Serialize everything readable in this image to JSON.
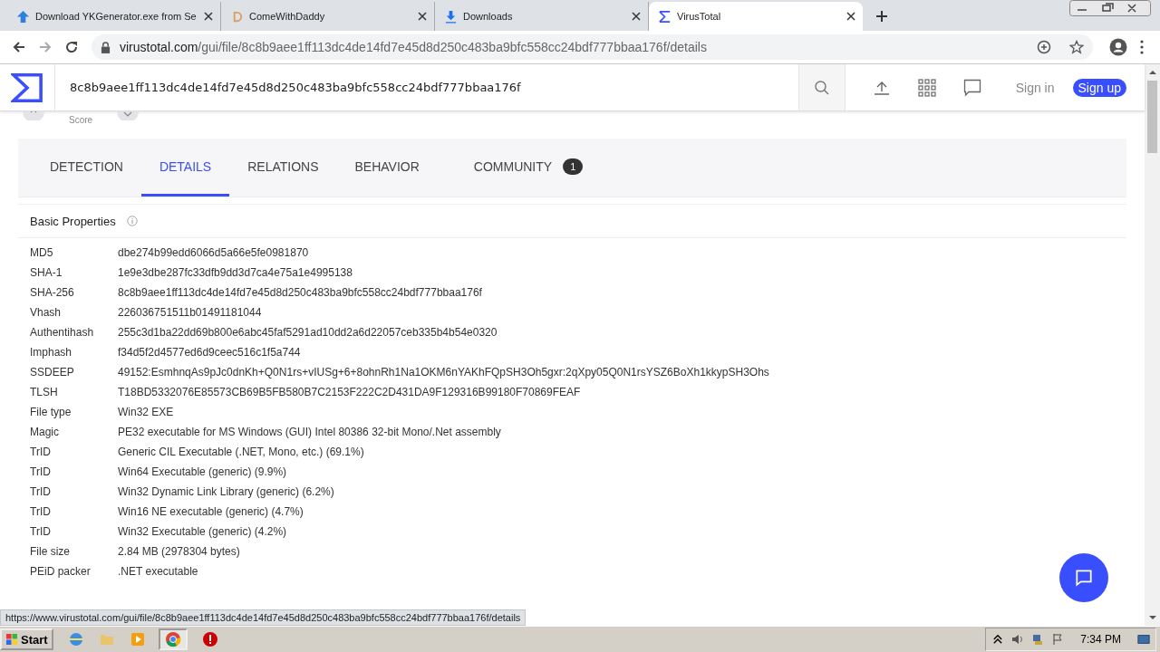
{
  "browser_tabs": [
    {
      "title": "Download YKGenerator.exe from Se",
      "selected": false
    },
    {
      "title": "ComeWithDaddy",
      "selected": false
    },
    {
      "title": "Downloads",
      "selected": false
    },
    {
      "title": "VirusTotal",
      "selected": true
    }
  ],
  "address_bar": {
    "host": "virustotal.com",
    "path": "/gui/file/8c8b9aee1ff113dc4de14fd7e45d8d250c483ba9bfc558cc24bdf777bbaa176f/details"
  },
  "site_header": {
    "search_value": "8c8b9aee1ff113dc4de14fd7e45d8d250c483ba9bfc558cc24bdf777bbaa176f",
    "sign_in": "Sign in",
    "sign_up": "Sign up"
  },
  "score_label": "Score",
  "section_tabs": [
    {
      "label": "DETECTION",
      "selected": false
    },
    {
      "label": "DETAILS",
      "selected": true
    },
    {
      "label": "RELATIONS",
      "selected": false
    },
    {
      "label": "BEHAVIOR",
      "selected": false
    },
    {
      "label": "COMMUNITY",
      "selected": false,
      "count": "1"
    }
  ],
  "basic_properties": {
    "title": "Basic Properties",
    "rows": [
      {
        "key": "MD5",
        "value": "dbe274b99edd6066d5a66e5fe0981870"
      },
      {
        "key": "SHA-1",
        "value": "1e9e3dbe287fc33dfb9dd3d7ca4e75a1e4995138"
      },
      {
        "key": "SHA-256",
        "value": "8c8b9aee1ff113dc4de14fd7e45d8d250c483ba9bfc558cc24bdf777bbaa176f"
      },
      {
        "key": "Vhash",
        "value": "226036751511b01491181044"
      },
      {
        "key": "Authentihash",
        "value": "255c3d1ba22dd69b800e6abc45faf5291ad10dd2a6d22057ceb335b4b54e0320"
      },
      {
        "key": "Imphash",
        "value": "f34d5f2d4577ed6d9ceec516c1f5a744"
      },
      {
        "key": "SSDEEP",
        "value": "49152:EsmhnqAs9pJc0dnKh+Q0N1rs+vIUSg+6+8ohnRh1Na1OKM6nYAKhFQpSH3Oh5gxr:2qXpy05Q0N1rsYSZ6BoXh1kkypSH3Ohs"
      },
      {
        "key": "TLSH",
        "value": "T18BD5332076E85573CB69B5FB580B7C2153F222C2D431DA9F129316B99180F70869FEAF"
      },
      {
        "key": "File type",
        "value": "Win32 EXE"
      },
      {
        "key": "Magic",
        "value": "PE32 executable for MS Windows (GUI) Intel 80386 32-bit Mono/.Net assembly"
      },
      {
        "key": "TrID",
        "value": "Generic CIL Executable (.NET, Mono, etc.) (69.1%)"
      },
      {
        "key": "TrID",
        "value": "Win64 Executable (generic) (9.9%)"
      },
      {
        "key": "TrID",
        "value": "Win32 Dynamic Link Library (generic) (6.2%)"
      },
      {
        "key": "TrID",
        "value": "Win16 NE executable (generic) (4.7%)"
      },
      {
        "key": "TrID",
        "value": "Win32 Executable (generic) (4.2%)"
      },
      {
        "key": "File size",
        "value": "2.84 MB (2978304 bytes)"
      },
      {
        "key": "PEiD packer",
        "value": ".NET executable"
      }
    ]
  },
  "status_url": "https://www.virustotal.com/gui/file/8c8b9aee1ff113dc4de14fd7e45d8d250c483ba9bfc558cc24bdf777bbaa176f/details",
  "taskbar": {
    "start": "Start",
    "clock": "7:34 PM"
  }
}
